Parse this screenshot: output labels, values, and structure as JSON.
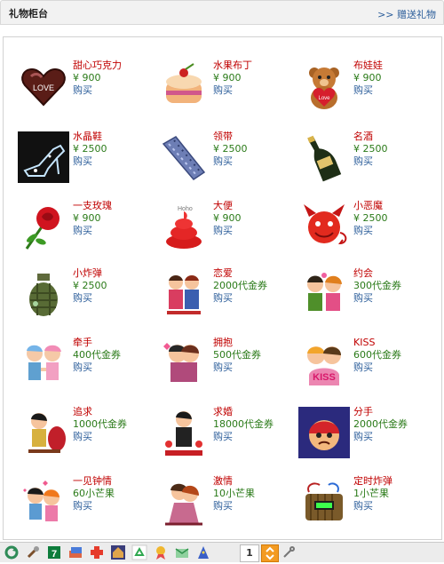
{
  "header": {
    "title": "礼物柜台",
    "link": ">> 赠送礼物"
  },
  "gifts": [
    {
      "name": "甜心巧克力",
      "price": "¥ 900",
      "buy": "购买"
    },
    {
      "name": "水果布丁",
      "price": "¥ 900",
      "buy": "购买"
    },
    {
      "name": "布娃娃",
      "price": "¥ 900",
      "buy": "购买"
    },
    {
      "name": "水晶鞋",
      "price": "¥ 2500",
      "buy": "购买"
    },
    {
      "name": "领带",
      "price": "¥ 2500",
      "buy": "购买"
    },
    {
      "name": "名酒",
      "price": "¥ 2500",
      "buy": "购买"
    },
    {
      "name": "一支玫瑰",
      "price": "¥ 900",
      "buy": "购买"
    },
    {
      "name": "大便",
      "price": "¥ 900",
      "buy": "购买"
    },
    {
      "name": "小恶魔",
      "price": "¥ 2500",
      "buy": "购买"
    },
    {
      "name": "小炸弹",
      "price": "¥ 2500",
      "buy": "购买"
    },
    {
      "name": "恋爱",
      "price": "2000代金券",
      "buy": "购买"
    },
    {
      "name": "约会",
      "price": "300代金券",
      "buy": "购买"
    },
    {
      "name": "牵手",
      "price": "400代金券",
      "buy": "购买"
    },
    {
      "name": "拥抱",
      "price": "500代金券",
      "buy": "购买"
    },
    {
      "name": "KISS",
      "price": "600代金券",
      "buy": "购买"
    },
    {
      "name": "追求",
      "price": "1000代金券",
      "buy": "购买"
    },
    {
      "name": "求婚",
      "price": "18000代金券",
      "buy": "购买"
    },
    {
      "name": "分手",
      "price": "2000代金券",
      "buy": "购买"
    },
    {
      "name": "一见钟情",
      "price": "60小芒果",
      "buy": "购买"
    },
    {
      "name": "激情",
      "price": "10小芒果",
      "buy": "购买"
    },
    {
      "name": "定时炸弹",
      "price": "1小芒果",
      "buy": "购买"
    }
  ],
  "icons": {
    "chocolate": "LOVE",
    "teddy": "Love",
    "poop": "Hoho",
    "kiss": "KISS"
  },
  "taskbar": {
    "page": "1",
    "items": [
      "refresh-icon",
      "tools-icon",
      "store-icon",
      "cards-icon",
      "plus-icon",
      "house-icon",
      "recycle-icon",
      "badge-icon",
      "mail-icon",
      "wizard-icon",
      "page-number",
      "scroll-icon",
      "settings-icon"
    ]
  }
}
